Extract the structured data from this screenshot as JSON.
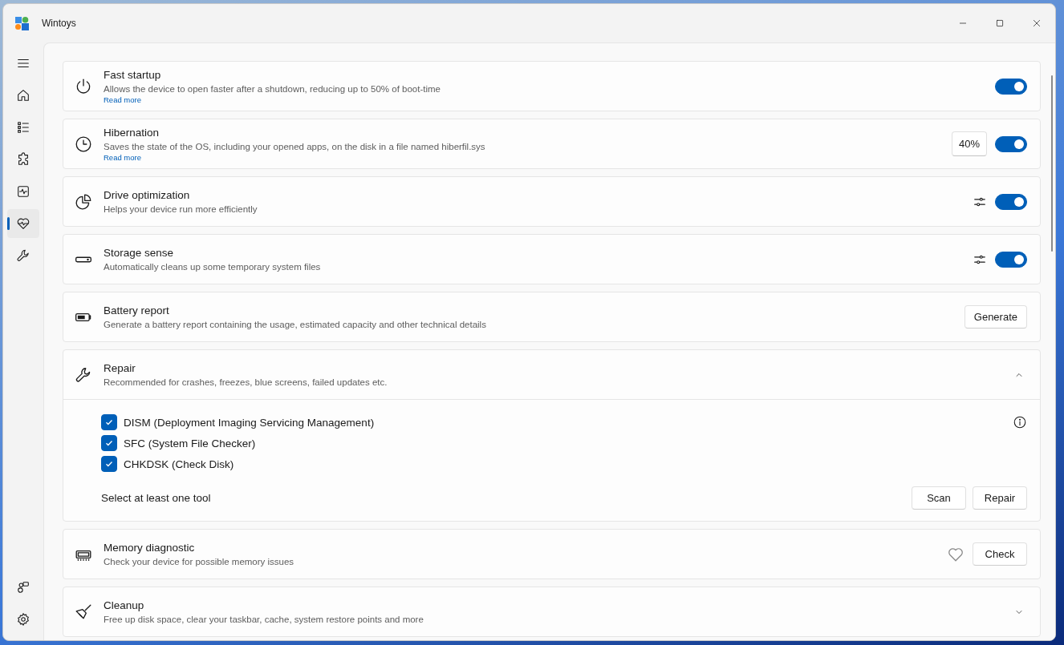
{
  "window": {
    "title": "Wintoys"
  },
  "sidebar": {
    "items": [
      {
        "selected": false
      },
      {
        "selected": false
      },
      {
        "selected": false
      },
      {
        "selected": false
      },
      {
        "selected": false
      },
      {
        "selected": true
      },
      {
        "selected": false
      }
    ],
    "footer_items": [
      {
        "selected": false
      },
      {
        "selected": false
      }
    ]
  },
  "settings": [
    {
      "title": "Fast startup",
      "description": "Allows the device to open faster after a shutdown, reducing up to 50% of boot-time",
      "link": "Read more",
      "controls": [
        {
          "kind": "toggle",
          "on": true
        }
      ]
    },
    {
      "title": "Hibernation",
      "description": "Saves the state of the OS, including your opened apps, on the disk in a file named hiberfil.sys",
      "link": "Read more",
      "controls": [
        {
          "kind": "value",
          "text": "40%"
        },
        {
          "kind": "toggle",
          "on": true
        }
      ]
    },
    {
      "title": "Drive optimization",
      "description": "Helps your device run more efficiently",
      "controls": [
        {
          "kind": "tune"
        },
        {
          "kind": "toggle",
          "on": true
        }
      ]
    },
    {
      "title": "Storage sense",
      "description": "Automatically cleans up some temporary system files",
      "controls": [
        {
          "kind": "tune"
        },
        {
          "kind": "toggle",
          "on": true
        }
      ]
    },
    {
      "title": "Battery report",
      "description": "Generate a battery report containing the usage, estimated capacity and other technical details",
      "controls": [
        {
          "kind": "button",
          "label": "Generate"
        }
      ]
    },
    {
      "title": "Repair",
      "description": "Recommended for crashes, freezes, blue screens, failed updates etc.",
      "controls": [
        {
          "kind": "chevron",
          "expanded": true
        }
      ],
      "body": {
        "options": [
          {
            "label": "DISM (Deployment Imaging Servicing Management)",
            "checked": true
          },
          {
            "label": "SFC (System File Checker)",
            "checked": true
          },
          {
            "label": "CHKDSK (Check Disk)",
            "checked": true
          }
        ],
        "hint": "Select at least one tool",
        "buttons": [
          "Scan",
          "Repair"
        ]
      }
    },
    {
      "title": "Memory diagnostic",
      "description": "Check your device for possible memory issues",
      "controls": [
        {
          "kind": "favorite"
        },
        {
          "kind": "button",
          "label": "Check"
        }
      ]
    },
    {
      "title": "Cleanup",
      "description": "Free up disk space, clear your taskbar, cache, system restore points and more",
      "controls": [
        {
          "kind": "chevron",
          "expanded": false
        }
      ]
    }
  ]
}
